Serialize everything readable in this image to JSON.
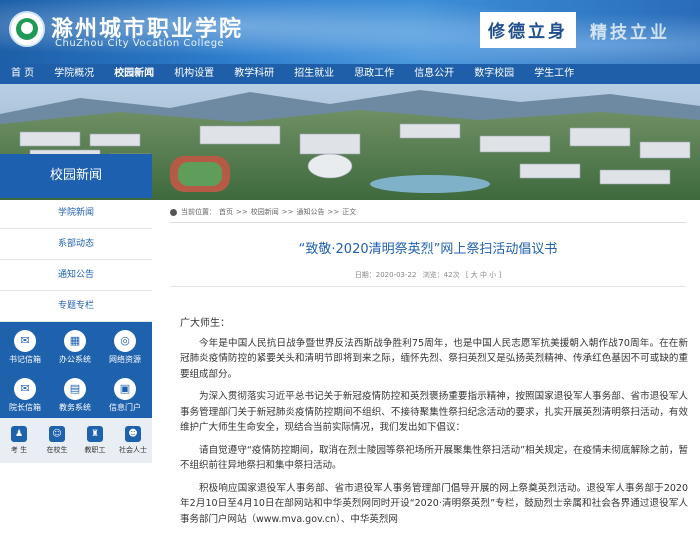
{
  "header": {
    "school_name_cn": "滁州城市职业学院",
    "school_name_en": "ChuZhou City Vocation College",
    "motto": "修德立身",
    "motto_second": "精技立业"
  },
  "nav": {
    "items": [
      "首 页",
      "学院概况",
      "校园新闻",
      "机构设置",
      "教学科研",
      "招生就业",
      "思政工作",
      "信息公开",
      "数字校园",
      "学生工作"
    ]
  },
  "sidebar": {
    "title": "校园新闻",
    "items": [
      "学院新闻",
      "系部动态",
      "通知公告",
      "专题专栏"
    ],
    "quick_links": [
      {
        "label": "书记信箱",
        "icon": "mail-icon",
        "glyph": "✉"
      },
      {
        "label": "办公系统",
        "icon": "office-icon",
        "glyph": "▦"
      },
      {
        "label": "网络资源",
        "icon": "globe-icon",
        "glyph": "◎"
      },
      {
        "label": "院长信箱",
        "icon": "mail-icon",
        "glyph": "✉"
      },
      {
        "label": "教务系统",
        "icon": "book-icon",
        "glyph": "▤"
      },
      {
        "label": "信息门户",
        "icon": "portal-icon",
        "glyph": "▣"
      }
    ],
    "user_types": [
      {
        "label": "考 生",
        "icon": "student-icon",
        "glyph": "♟"
      },
      {
        "label": "在校生",
        "icon": "user-icon",
        "glyph": "☺"
      },
      {
        "label": "教职工",
        "icon": "teacher-icon",
        "glyph": "♜"
      },
      {
        "label": "社会人士",
        "icon": "people-icon",
        "glyph": "☻"
      }
    ]
  },
  "breadcrumb": {
    "prefix": "当前位置：",
    "items": [
      "首页",
      ">>",
      "校园新闻",
      ">>",
      "通知公告",
      ">>",
      "正文"
    ]
  },
  "article": {
    "title": "“致敬·2020清明祭英烈”网上祭扫活动倡议书",
    "date": "日期：2020-03-22",
    "views": "浏览：42次",
    "font_size": "[ 大 中 小 ]",
    "greeting": "广大师生：",
    "paragraphs": [
      "今年是中国人民抗日战争暨世界反法西斯战争胜利75周年，也是中国人民志愿军抗美援朝入朝作战70周年。在在新冠肺炎疫情防控的紧要关头和清明节即将到来之际，缅怀先烈、祭扫英烈又是弘扬英烈精神、传承红色基因不可或缺的重要组成部分。",
      "为深入贯彻落实习近平总书记关于新冠疫情防控和英烈褒扬重要指示精神，按照国家退役军人事务部、省市退役军人事务管理部门关于新冠肺炎疫情防控期间不组织、不接待聚集性祭扫纪念活动的要求，扎实开展英烈清明祭扫活动，有效维护广大师生生命安全，现结合当前实际情况，我们发出如下倡议：",
      "请自觉遵守“疫情防控期间，取消在烈士陵园等祭祀场所开展聚集性祭扫活动”相关规定，在疫情未彻底解除之前，暂不组织前往异地祭扫和集中祭扫活动。",
      "积极响应国家退役军人事务部、省市退役军人事务管理部门倡导开展的网上祭奠英烈活动。退役军人事务部于2020年2月10日至4月10日在部网站和中华英烈网同时开设“2020·清明祭英烈”专栏，鼓励烈士亲属和社会各界通过退役军人事务部门户网站（www.mva.gov.cn）、中华英烈网"
    ]
  }
}
